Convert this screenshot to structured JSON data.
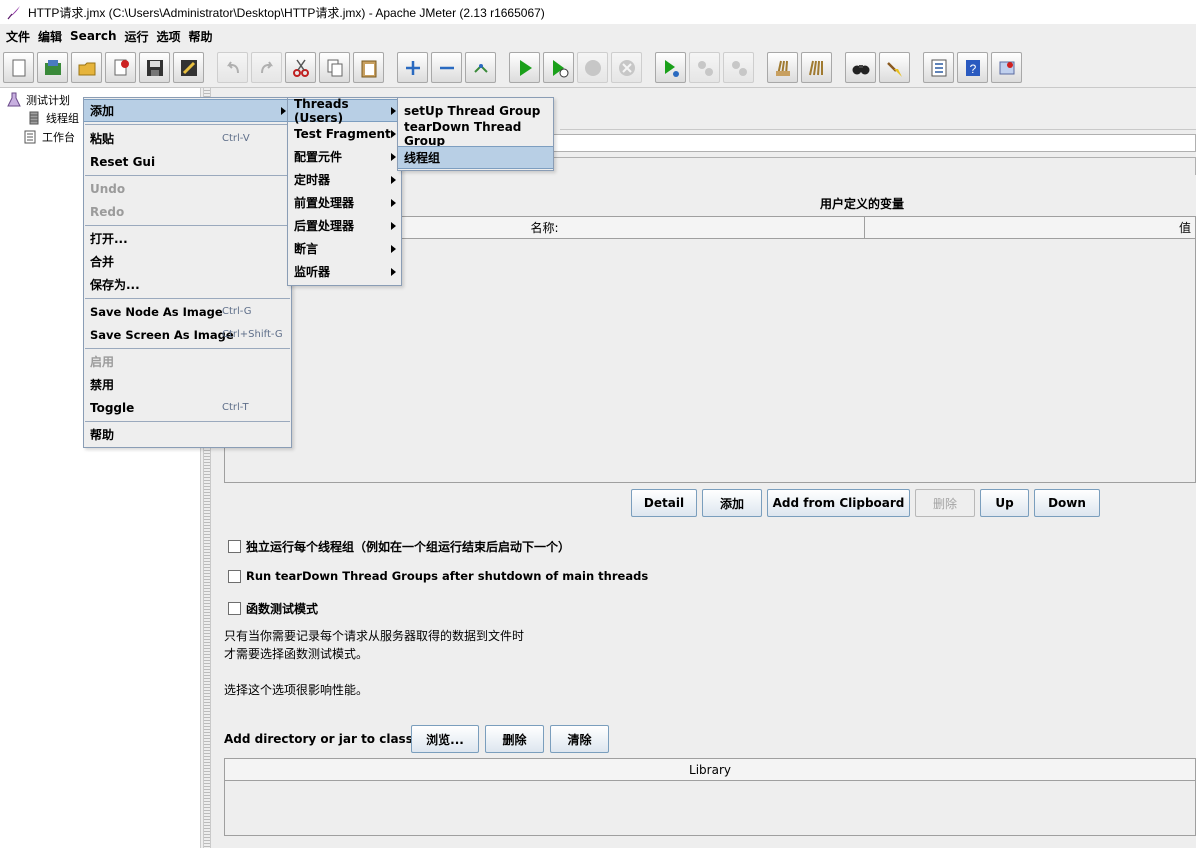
{
  "window": {
    "title": "HTTP请求.jmx (C:\\Users\\Administrator\\Desktop\\HTTP请求.jmx) - Apache JMeter (2.13 r1665067)"
  },
  "menubar": [
    "文件",
    "编辑",
    "Search",
    "运行",
    "选项",
    "帮助"
  ],
  "toolbar": {
    "icons": [
      "new-icon",
      "templates-icon",
      "open-icon",
      "close-icon",
      "save-icon",
      "save-as-image-icon",
      "undo-icon",
      "redo-icon",
      "cut-icon",
      "copy-icon",
      "paste-icon",
      "expand-icon",
      "collapse-icon",
      "toggle-icon",
      "start-icon",
      "start-no-timers-icon",
      "stop-icon",
      "shutdown-icon",
      "remote-start-icon",
      "remote-stop-icon",
      "remote-exit-icon",
      "clear-icon",
      "clear-all-icon",
      "search-icon",
      "reset-search-icon",
      "function-helper-icon",
      "help-icon",
      "log-viewer-icon"
    ]
  },
  "tree": {
    "nodes": [
      "测试计划",
      "线程组",
      "工作台"
    ]
  },
  "context_menu": {
    "items": [
      "添加",
      "粘贴",
      "Reset Gui",
      "Undo",
      "Redo",
      "打开...",
      "合并",
      "保存为...",
      "Save Node As Image",
      "Save Screen As Image",
      "启用",
      "禁用",
      "Toggle",
      "帮助"
    ],
    "accelerators": {
      "paste": "Ctrl-V",
      "save_node": "Ctrl-G",
      "save_screen": "Ctrl+Shift-G",
      "toggle": "Ctrl-T"
    }
  },
  "add_submenu": {
    "items": [
      "Threads (Users)",
      "Test Fragment",
      "配置元件",
      "定时器",
      "前置处理器",
      "后置处理器",
      "断言",
      "监听器"
    ]
  },
  "threads_submenu": {
    "items": [
      "setUp Thread Group",
      "tearDown Thread Group",
      "线程组"
    ]
  },
  "main": {
    "vars_title": "用户定义的变量",
    "vars_columns": [
      "名称:",
      "值"
    ],
    "buttons": [
      "Detail",
      "添加",
      "Add from Clipboard",
      "删除",
      "Up",
      "Down"
    ],
    "options": [
      "独立运行每个线程组（例如在一个组运行结束后启动下一个）",
      "Run tearDown Thread Groups after shutdown of main threads",
      "函数测试模式"
    ],
    "notes": [
      "只有当你需要记录每个请求从服务器取得的数据到文件时",
      "才需要选择函数测试模式。",
      "选择这个选项很影响性能。"
    ],
    "classpath_label": "Add directory or jar to classpath",
    "classpath_buttons": [
      "浏览...",
      "删除",
      "清除"
    ],
    "library_header": "Library"
  }
}
